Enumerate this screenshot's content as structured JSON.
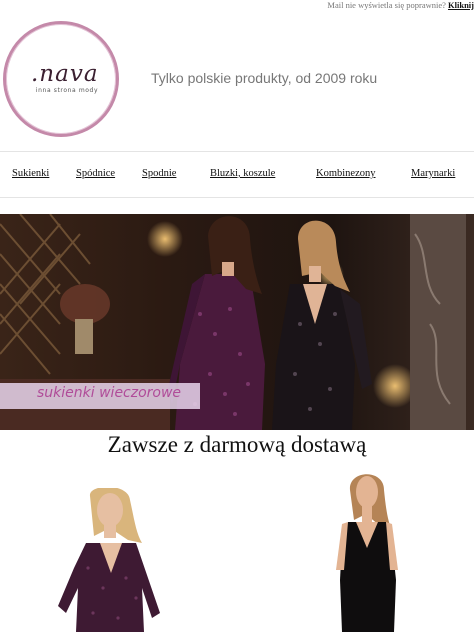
{
  "header": {
    "notice_text": "Mail nie wyświetla się poprawnie?",
    "notice_link": "Kliknij",
    "logo_word": ".nava",
    "logo_tagline": "inna strona mody",
    "tagline": "Tylko polskie produkty, od 2009 roku"
  },
  "nav": {
    "items": [
      {
        "label": "Sukienki"
      },
      {
        "label": "Spódnice"
      },
      {
        "label": "Spodnie"
      },
      {
        "label": "Bluzki, koszule"
      },
      {
        "label": "Kombinezony"
      },
      {
        "label": "Marynarki"
      }
    ]
  },
  "banner": {
    "label": "sukienki wieczorowe"
  },
  "main": {
    "headline": "Zawsze z darmową dostawą"
  },
  "colors": {
    "brand_ring": "#c489a9",
    "banner_label_text": "#b04c99",
    "banner_label_bg": "#e8d5ec"
  }
}
